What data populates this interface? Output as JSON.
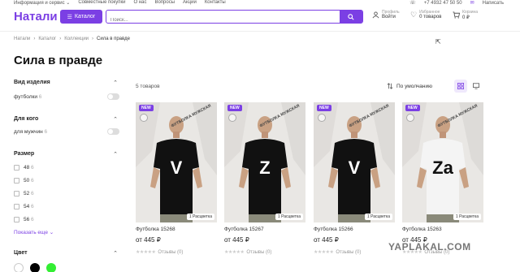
{
  "topbar": {
    "links": [
      "Информация и сервис ⌄",
      "Совместные покупки",
      "О нас",
      "Вопросы",
      "Акции",
      "Контакты"
    ],
    "phone": "+7 4932 47 50 50",
    "write": "Написать"
  },
  "header": {
    "logo": "Натали",
    "catalog_label": "Каталог",
    "search_placeholder": "Поиск...",
    "profile_label": "Профиль",
    "profile_value": "Войти",
    "favorites_label": "Избранное",
    "favorites_value": "0 товаров",
    "cart_label": "Корзина",
    "cart_value": "0 ₽"
  },
  "breadcrumb": [
    "Натали",
    "Каталог",
    "Коллекции",
    "Сила в правде"
  ],
  "page_title": "Сила в правде",
  "filters": {
    "type": {
      "title": "Вид изделия",
      "option": "футболки",
      "count": "6"
    },
    "for_whom": {
      "title": "Для кого",
      "option": "для мужчин",
      "count": "6"
    },
    "size": {
      "title": "Размер",
      "options": [
        {
          "label": "48",
          "count": "6"
        },
        {
          "label": "50",
          "count": "6"
        },
        {
          "label": "52",
          "count": "6"
        },
        {
          "label": "54",
          "count": "6"
        },
        {
          "label": "56",
          "count": "6"
        }
      ],
      "show_more": "Показать еще ⌄"
    },
    "color": {
      "title": "Цвет",
      "swatches": [
        "#ffffff",
        "#000000",
        "#33ee33"
      ]
    }
  },
  "toolbar": {
    "count": "5 товаров",
    "sort": "По умолчанию",
    "accent": "#7b3fe4"
  },
  "products": [
    {
      "name": "Футболка 15268",
      "price": "от 445 ₽",
      "reviews": "Отзывы (0)",
      "badge": "NEW",
      "ribbon": "ФУТБОЛКА МУЖСКАЯ",
      "pack": "1 Расцветка",
      "shirt": "#111111",
      "print": "V",
      "print_color": "#ffffff"
    },
    {
      "name": "Футболка 15267",
      "price": "от 445 ₽",
      "reviews": "Отзывы (0)",
      "badge": "NEW",
      "ribbon": "ФУТБОЛКА МУЖСКАЯ",
      "pack": "1 Расцветка",
      "shirt": "#111111",
      "print": "Z",
      "print_color": "#ffffff"
    },
    {
      "name": "Футболка 15266",
      "price": "от 445 ₽",
      "reviews": "Отзывы (0)",
      "badge": "NEW",
      "ribbon": "ФУТБОЛКА МУЖСКАЯ",
      "pack": "1 Расцветка",
      "shirt": "#111111",
      "print": "V",
      "print_color": "#ffffff"
    },
    {
      "name": "Футболка 15263",
      "price": "от 445 ₽",
      "reviews": "Отзывы (0)",
      "badge": "NEW",
      "ribbon": "ФУТБОЛКА МУЖСКАЯ",
      "pack": "1 Расцветка",
      "shirt": "#f4f4f4",
      "print": "Za",
      "print_color": "#111111"
    }
  ],
  "watermark": "YAPLAKAL.COM"
}
